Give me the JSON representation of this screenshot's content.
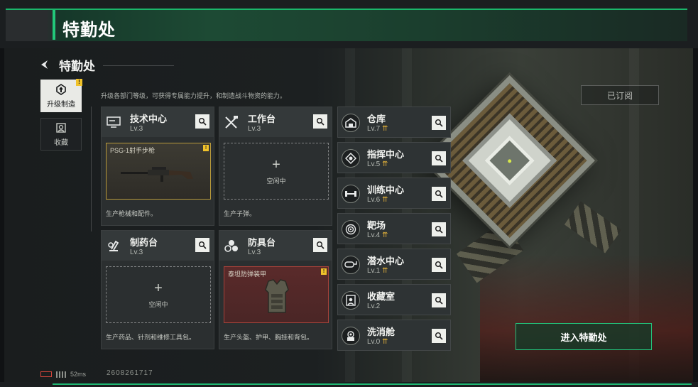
{
  "header": {
    "title": "特勤处"
  },
  "breadcrumb": {
    "title": "特勤处"
  },
  "description": "升级各部门等级，可获得专属能力提升，和制造战斗物资的能力。",
  "side_tabs": [
    {
      "label": "升级制造",
      "badge": "!",
      "active": true,
      "icon": "upgrade-icon"
    },
    {
      "label": "收藏",
      "active": false,
      "icon": "collection-icon"
    }
  ],
  "cards": [
    {
      "name": "技术中心",
      "level": "Lv.3",
      "icon": "tech-center-icon",
      "slot": {
        "type": "item",
        "item_name": "PSG-1射手步枪",
        "badge": "!"
      },
      "footer": "生产枪械和配件。"
    },
    {
      "name": "工作台",
      "level": "Lv.3",
      "icon": "workbench-icon",
      "slot": {
        "type": "empty",
        "plus": "+",
        "idle": "空闲中"
      },
      "footer": "生产子弹。"
    },
    {
      "name": "制药台",
      "level": "Lv.3",
      "icon": "pharmacy-icon",
      "slot": {
        "type": "empty",
        "plus": "+",
        "idle": "空闲中"
      },
      "footer": "生产药品、针剂和维修工具包。"
    },
    {
      "name": "防具台",
      "level": "Lv.3",
      "icon": "armor-bench-icon",
      "slot": {
        "type": "item",
        "item_name": "泰坦防弹装甲",
        "badge": "!"
      },
      "footer": "生产头盔、护甲、胸挂和背包。"
    }
  ],
  "facilities": [
    {
      "name": "仓库",
      "level": "Lv.7",
      "upgradable": true,
      "icon": "warehouse-icon"
    },
    {
      "name": "指挥中心",
      "level": "Lv.5",
      "upgradable": true,
      "icon": "command-center-icon"
    },
    {
      "name": "训练中心",
      "level": "Lv.6",
      "upgradable": true,
      "icon": "training-center-icon"
    },
    {
      "name": "靶场",
      "level": "Lv.4",
      "upgradable": true,
      "icon": "shooting-range-icon"
    },
    {
      "name": "潜水中心",
      "level": "Lv.1",
      "upgradable": true,
      "icon": "diving-center-icon"
    },
    {
      "name": "收藏室",
      "level": "Lv.2",
      "upgradable": false,
      "icon": "collection-room-icon"
    },
    {
      "name": "洗消舱",
      "level": "Lv.0",
      "upgradable": true,
      "icon": "decon-chamber-icon"
    }
  ],
  "upgrade_glyph": "⇈",
  "subscribed_label": "已订阅",
  "enter_button": "进入特勤处",
  "status": {
    "ping": "52ms",
    "uid": "2608261717"
  },
  "colors": {
    "accent_green": "#1fb772",
    "badge_yellow": "#f0c22a",
    "upgrade_gold": "#e8b53a"
  }
}
